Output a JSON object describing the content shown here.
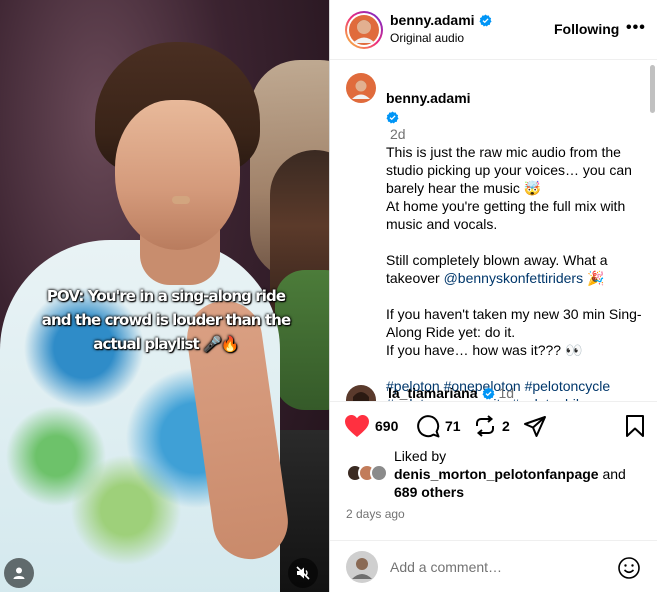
{
  "video": {
    "overlay_text": "POV: You're in a sing-along ride and the crowd is louder than the actual playlist 🎤🔥",
    "buttons": {
      "user_tags_icon": "user-icon",
      "mute_icon": "muted-speaker-icon"
    }
  },
  "header": {
    "username": "benny.adami",
    "subtitle": "Original audio",
    "follow_label": "Following",
    "more_label": "•••"
  },
  "caption": {
    "username": "benny.adami",
    "time": "2d",
    "line1": "This is just the raw mic audio from the studio picking up your voices… you can barely hear the music 🤯",
    "line2": "At home you're getting the full mix with music and vocals.",
    "line3a": "Still completely blown away. What a takeover ",
    "mention": "@bennyskonfettiriders",
    "line3b": " 🎉",
    "line4": "If you haven't taken my new 30 min Sing-Along Ride yet: do it.",
    "line5": "If you have… how was it??? 👀",
    "hashtags": "#peloton #onepeloton #pelotoncycle #pelotoncommunity #pelotonbike"
  },
  "comment_preview": {
    "username": "la_tiamariana",
    "time": "1d"
  },
  "actions": {
    "likes": "690",
    "comments": "71",
    "reposts": "2"
  },
  "liked_by": {
    "label": "Liked by",
    "user": "denis_morton_pelotonfanpage",
    "and": " and",
    "others": "689 others"
  },
  "date": "2 days ago",
  "add_comment": {
    "placeholder": "Add a comment…"
  },
  "colors": {
    "heart": "#ff3040",
    "verified": "#0095f6",
    "link": "#00376b",
    "secondary_text": "#737373"
  }
}
